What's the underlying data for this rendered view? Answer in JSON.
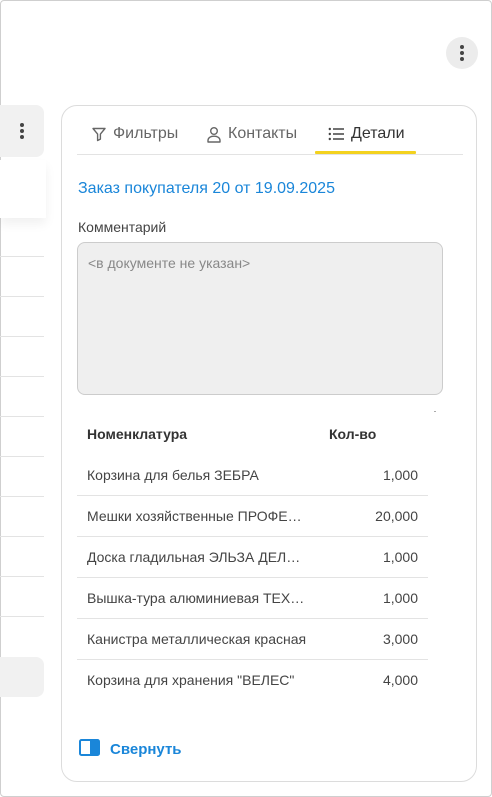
{
  "tabs": [
    {
      "label": "Фильтры",
      "icon": "filter-icon",
      "active": false
    },
    {
      "label": "Контакты",
      "icon": "user-icon",
      "active": false
    },
    {
      "label": "Детали",
      "icon": "list-icon",
      "active": true
    }
  ],
  "document": {
    "title": "Заказ покупателя 20 от 19.09.2025"
  },
  "comment": {
    "label": "Комментарий",
    "placeholder": "<в документе не указан>"
  },
  "table": {
    "headers": [
      "Номенклатура",
      "Кол-во"
    ],
    "rows": [
      {
        "name": "Корзина для белья ЗЕБРА",
        "qty": "1,000"
      },
      {
        "name": "Мешки хозяйственные ПРОФЕССИОНАЛ",
        "qty": "20,000"
      },
      {
        "name": "Доска гладильная  ЭЛЬЗА ДЕЛЮКС",
        "qty": "1,000"
      },
      {
        "name": "Вышка-тура алюминиевая ТЕХНО",
        "qty": "1,000"
      },
      {
        "name": "Канистра металлическая красная",
        "qty": "3,000"
      },
      {
        "name": "Корзина для хранения \"ВЕЛЕС\"",
        "qty": "4,000"
      }
    ]
  },
  "collapse": {
    "label": "Свернуть",
    "icon": "panel-collapse-icon"
  },
  "colors": {
    "accent": "#1a86d9",
    "tab_underline": "#f3d21f",
    "field_bg": "#efefef"
  }
}
